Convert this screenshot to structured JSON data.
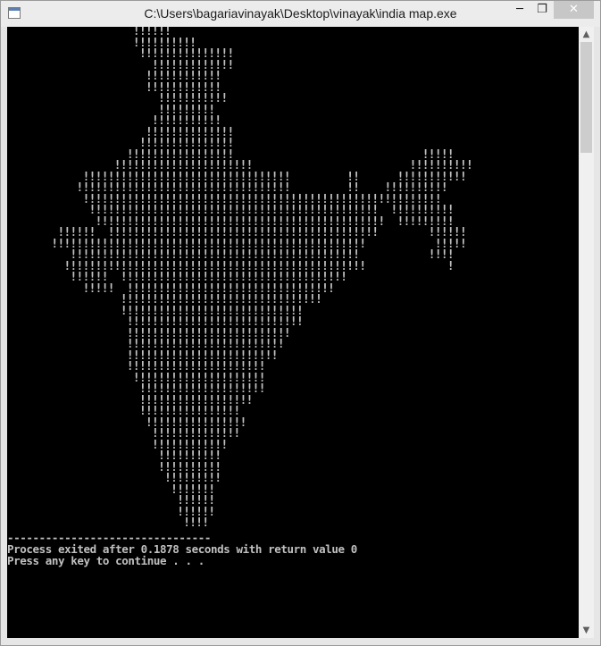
{
  "window": {
    "title": "C:\\Users\\bagariavinayak\\Desktop\\vinayak\\india map.exe",
    "controls": {
      "minimize": "─",
      "maximize": "❐",
      "close": "✕"
    }
  },
  "console": {
    "map_lines": [
      "                    !!!!!!",
      "                    !!!!!!!!!!",
      "                     !!!!!!!!!!!!!!!",
      "                       !!!!!!!!!!!!!",
      "                      !!!!!!!!!!!!",
      "                      !!!!!!!!!!!!",
      "                        !!!!!!!!!!!",
      "                        !!!!!!!!!",
      "                       !!!!!!!!!!!",
      "                      !!!!!!!!!!!!!!",
      "                     !!!!!!!!!!!!!!!",
      "                   !!!!!!!!!!!!!!!!!                              !!!!!",
      "                 !!!!!!!!!!!!!!!!!!!!!!                         !!!!!!!!!!",
      "            !!!!!!!!!!!!!!!!!!!!!!!!!!!!!!!!!         !!      !!!!!!!!!!!",
      "           !!!!!!!!!!!!!!!!!!!!!!!!!!!!!!!!!!         !!    !!!!!!!!!!",
      "            !!!!!!!!!!!!!!!!!!!!!!!!!!!!!!!!!!!!!!!!!!!!!!!!!!!!!!!!!",
      "             !!!!!!!!!!!!!!!!!!!!!!!!!!!!!!!!!!!!!!!!!!!!!!  !!!!!!!!!!",
      "              !!!!!!!!!!!!!!!!!!!!!!!!!!!!!!!!!!!!!!!!!!!!!!  !!!!!!!!!",
      "        !!!!!!  !!!!!!!!!!!!!!!!!!!!!!!!!!!!!!!!!!!!!!!!!!!        !!!!!!",
      "       !!!!!!!!!!!!!!!!!!!!!!!!!!!!!!!!!!!!!!!!!!!!!!!!!!           !!!!!",
      "          !!!!!!!!!!!!!!!!!!!!!!!!!!!!!!!!!!!!!!!!!!!!!!           !!!!",
      "         !!!!!!!!!!!!!!!!!!!!!!!!!!!!!!!!!!!!!!!!!!!!!!!!             !",
      "          !!!!!!  !!!!!!!!!!!!!!!!!!!!!!!!!!!!!!!!!!!!",
      "            !!!!!  !!!!!!!!!!!!!!!!!!!!!!!!!!!!!!!!!",
      "                  !!!!!!!!!!!!!!!!!!!!!!!!!!!!!!!!",
      "                  !!!!!!!!!!!!!!!!!!!!!!!!!!!!!",
      "                   !!!!!!!!!!!!!!!!!!!!!!!!!!!!",
      "                   !!!!!!!!!!!!!!!!!!!!!!!!!!",
      "                   !!!!!!!!!!!!!!!!!!!!!!!!!",
      "                   !!!!!!!!!!!!!!!!!!!!!!!!",
      "                   !!!!!!!!!!!!!!!!!!!!!!",
      "                    !!!!!!!!!!!!!!!!!!!!!",
      "                     !!!!!!!!!!!!!!!!!!!!",
      "                     !!!!!!!!!!!!!!!!!!",
      "                     !!!!!!!!!!!!!!!!",
      "                      !!!!!!!!!!!!!!!!",
      "                       !!!!!!!!!!!!!!",
      "                       !!!!!!!!!!!!",
      "                        !!!!!!!!!!",
      "                        !!!!!!!!!!",
      "                         !!!!!!!!!",
      "                          !!!!!!!",
      "                           !!!!!!",
      "                           !!!!!!",
      "                            !!!!"
    ],
    "separator": "--------------------------------",
    "exit_message": "Process exited after 0.1878 seconds with return value 0",
    "continue_prompt": "Press any key to continue . . ."
  },
  "scrollbar": {
    "up_arrow": "▲",
    "down_arrow": "▼"
  },
  "icons": {
    "app": "console-app-icon"
  }
}
